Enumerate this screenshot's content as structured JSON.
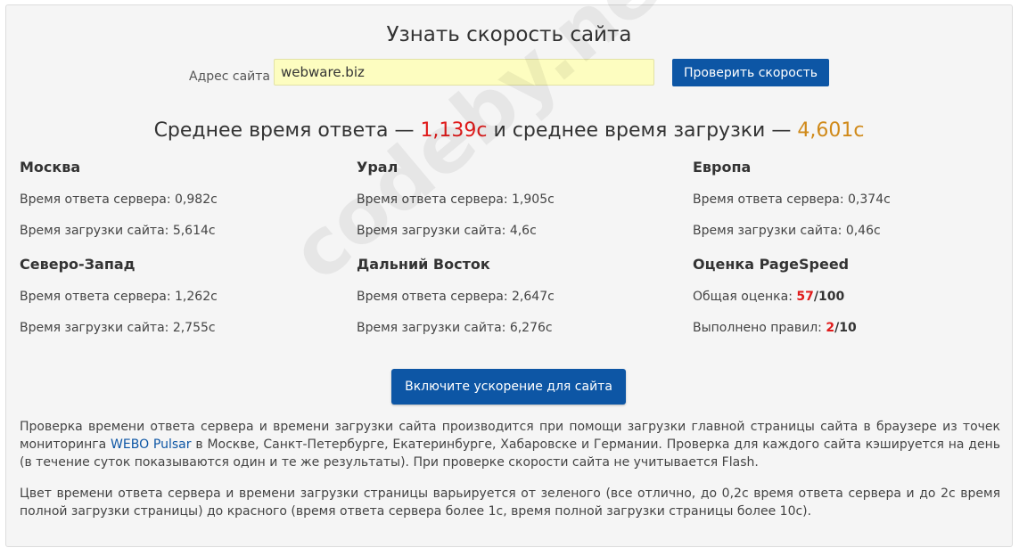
{
  "page_title": "Узнать скорость сайта",
  "form": {
    "url_label": "Адрес сайта",
    "url_value": "webware.biz",
    "check_button": "Проверить скорость"
  },
  "summary": {
    "prefix": "Среднее время ответа — ",
    "response_value": "1,139с",
    "middle": " и среднее время загрузки — ",
    "load_value": "4,601с"
  },
  "regions": [
    {
      "name": "Москва",
      "response_label": "Время ответа сервера: ",
      "response": "0,982с",
      "load_label": "Время загрузки сайта: ",
      "load": "5,614с"
    },
    {
      "name": "Урал",
      "response_label": "Время ответа сервера: ",
      "response": "1,905с",
      "load_label": "Время загрузки сайта: ",
      "load": "4,6с"
    },
    {
      "name": "Европа",
      "response_label": "Время ответа сервера: ",
      "response": "0,374с",
      "load_label": "Время загрузки сайта: ",
      "load": "0,46с"
    },
    {
      "name": "Северо-Запад",
      "response_label": "Время ответа сервера: ",
      "response": "1,262с",
      "load_label": "Время загрузки сайта: ",
      "load": "2,755с"
    },
    {
      "name": "Дальний Восток",
      "response_label": "Время ответа сервера: ",
      "response": "2,647с",
      "load_label": "Время загрузки сайта: ",
      "load": "6,276с"
    }
  ],
  "pagespeed": {
    "title": "Оценка PageSpeed",
    "score_label": "Общая оценка: ",
    "score": "57",
    "score_max": "/100",
    "rules_label": "Выполнено правил: ",
    "rules": "2",
    "rules_max": "/10"
  },
  "accel_button": "Включите ускорение для сайта",
  "para1": {
    "before_link": "Проверка времени ответа сервера и времени загрузки сайта производится при помощи загрузки главной страницы сайта в браузере из точек мониторинга ",
    "link": "WEBO Pulsar",
    "after_link": " в Москве, Санкт-Петербурге, Екатеринбурге, Хабаровске и Германии. Проверка для каждого сайта кэшируется на день (в течение суток показываются один и те же результаты). При проверке скорости сайта не учитывается Flash."
  },
  "para2": "Цвет времени ответа сервера и времени загрузки страницы варьируется от зеленого (все отлично, до 0,2с время ответа сервера и до 2с время полной загрузки страницы) до красного (время ответа сервера более 1с, время полной загрузки страницы более 10с).",
  "watermark": "codeby.net",
  "colors": {
    "accent": "#0d56a5",
    "input_bg": "#fdfdc0",
    "bad": "#e01b1b",
    "warn": "#d08a1a"
  }
}
